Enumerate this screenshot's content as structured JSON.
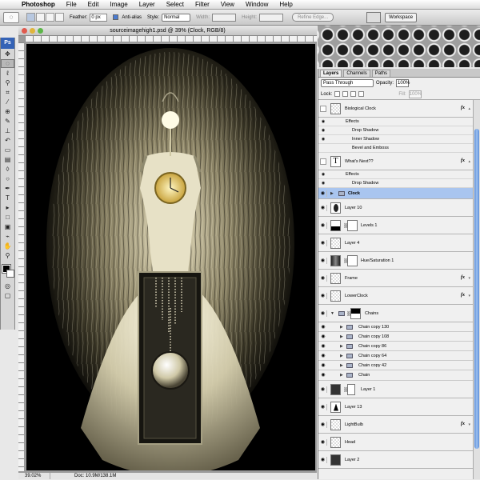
{
  "menubar": {
    "app": "Photoshop",
    "items": [
      "File",
      "Edit",
      "Image",
      "Layer",
      "Select",
      "Filter",
      "View",
      "Window",
      "Help"
    ]
  },
  "options": {
    "feather_label": "Feather:",
    "feather_value": "0 px",
    "antialias_label": "Anti-alias",
    "style_label": "Style:",
    "style_value": "Normal",
    "width_label": "Width:",
    "height_label": "Height:",
    "refine_edge": "Refine Edge...",
    "workspace": "Workspace"
  },
  "toolbox": {
    "logo": "Ps"
  },
  "document": {
    "title": "sourceimagehigh1.psd @ 39% (Clock, RGB/8)",
    "zoom": "39.02%",
    "doc_info": "Doc: 10.9M/138.1M"
  },
  "layers_panel": {
    "tabs": [
      "Layers",
      "Channels",
      "Paths"
    ],
    "blend_mode": "Pass Through",
    "opacity_label": "Opacity:",
    "opacity_value": "100%",
    "lock_label": "Lock:",
    "fill_label": "Fill:",
    "fill_value": "100%",
    "biological_clock": "Biological Clock",
    "effects": "Effects",
    "drop_shadow": "Drop Shadow",
    "inner_shadow": "Inner Shadow",
    "bevel_emboss": "Bevel and Emboss",
    "whats_next": "What's                Next??",
    "clock_group": "Clock",
    "layer10": "Layer 10",
    "levels1": "Levels 1",
    "layer4": "Layer 4",
    "huesat1": "Hue/Saturation 1",
    "frame": "Frame",
    "lowerclock": "LowerClock",
    "chains": "Chains",
    "chain_copies": [
      "Chain copy 130",
      "Chain copy 108",
      "Chain copy 86",
      "Chain copy 64",
      "Chain copy 42",
      "Chain"
    ],
    "layer1": "Layer 1",
    "layer13": "Layer 13",
    "lightbulb": "LightBulb",
    "head": "Head",
    "layer2": "Layer 2",
    "fx": "fx"
  }
}
